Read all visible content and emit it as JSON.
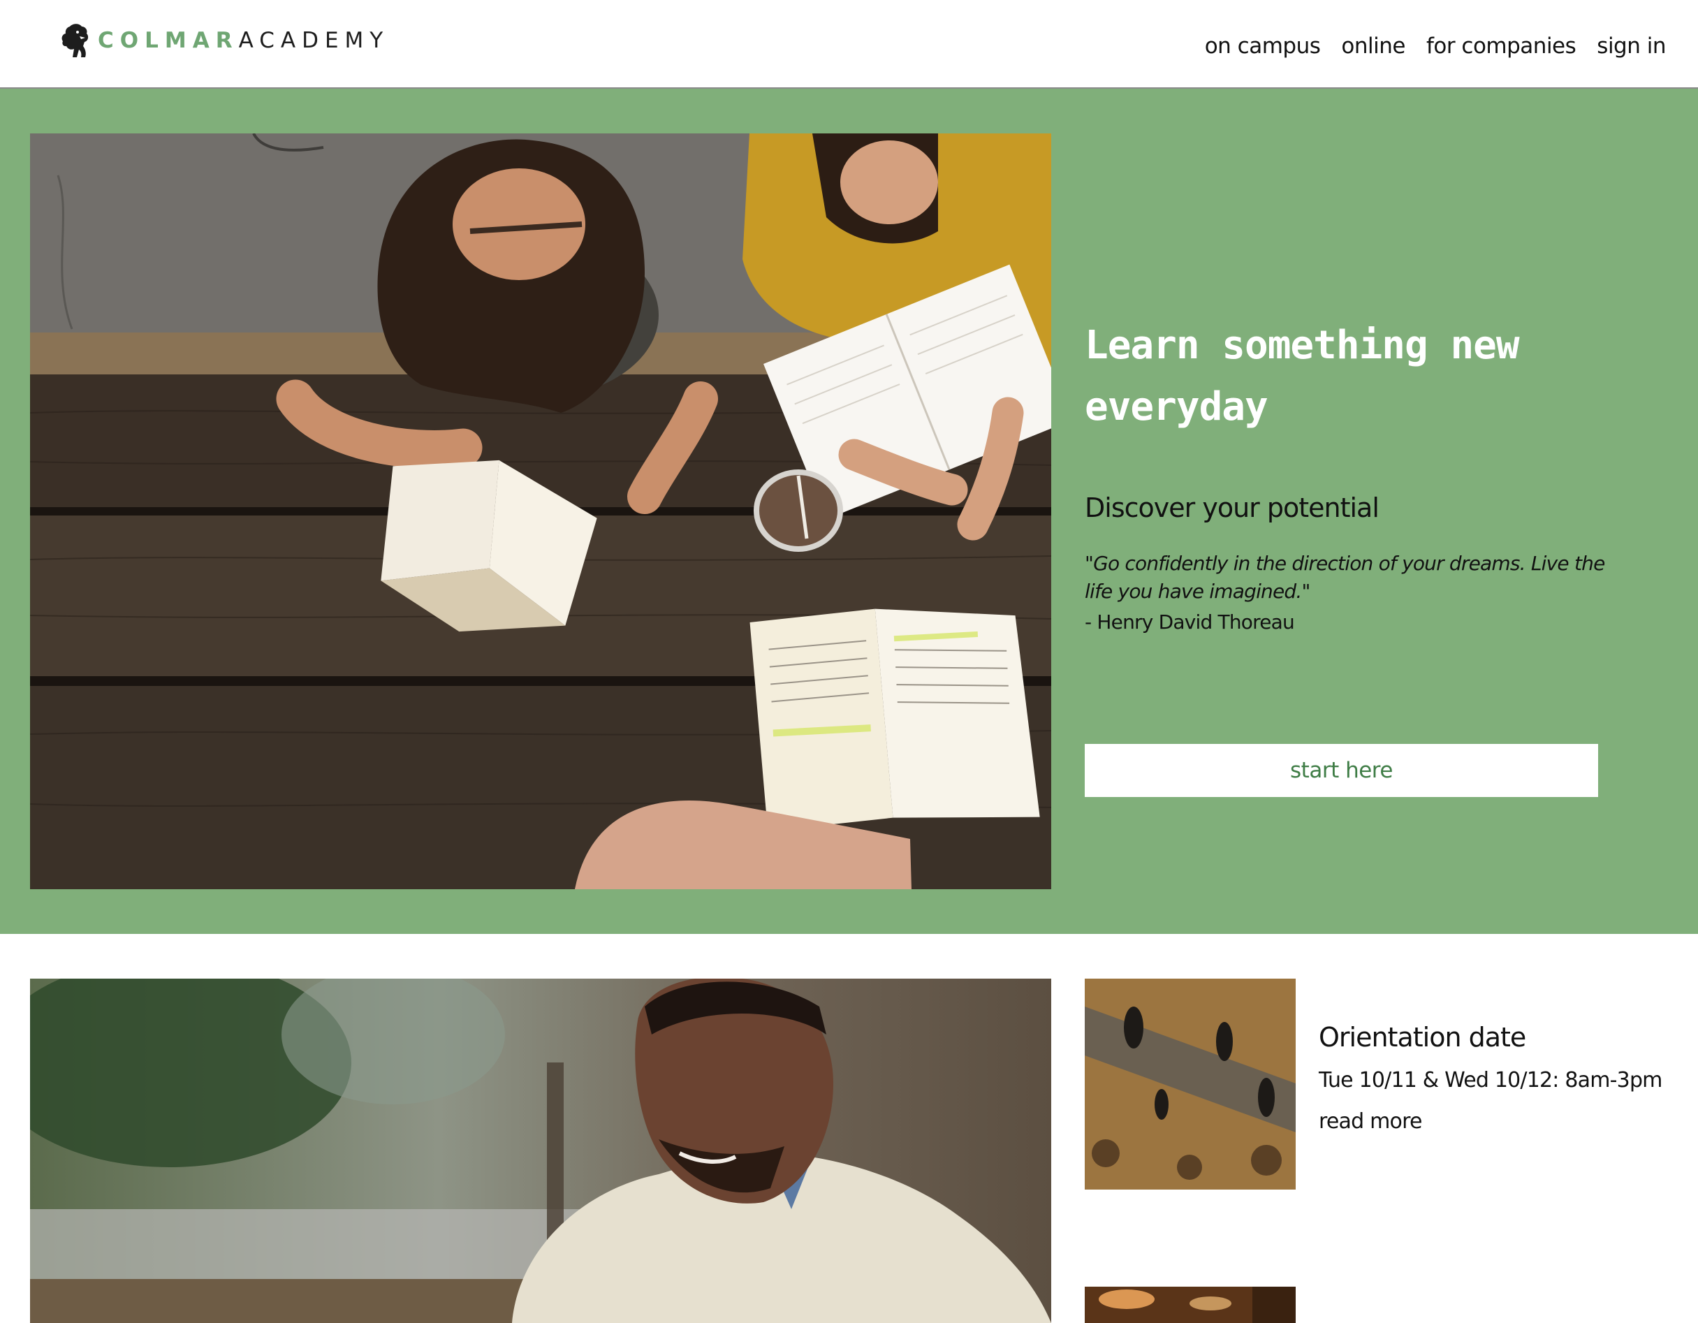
{
  "brand": {
    "name_part1": "COLMAR",
    "name_part2": "ACADEMY",
    "logo_icon": "lion-icon",
    "accent_color": "#6fa673"
  },
  "nav": {
    "items": [
      {
        "label": "on campus"
      },
      {
        "label": "online"
      },
      {
        "label": "for companies"
      },
      {
        "label": "sign in"
      }
    ]
  },
  "hero": {
    "background_color": "#80af7a",
    "title_line1": "Learn something new",
    "title_line2": "everyday",
    "subtitle": "Discover your potential",
    "quote": "\"Go confidently in the direction of your dreams. Live the life you have imagined.\"",
    "author": "- Henry David Thoreau",
    "cta_label": "start here"
  },
  "events": {
    "items": [
      {
        "title": "Orientation date",
        "date": "Tue 10/11 & Wed 10/12: 8am-3pm",
        "link": "read more"
      }
    ]
  }
}
